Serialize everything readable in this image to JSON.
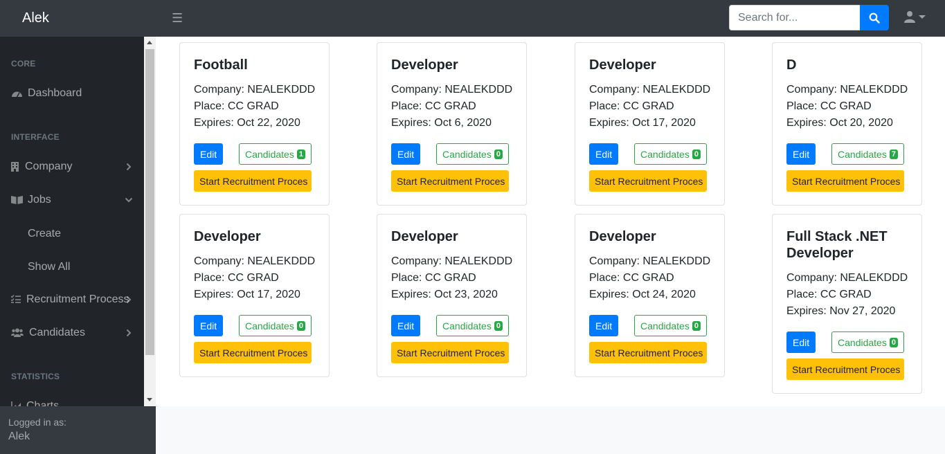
{
  "navbar": {
    "brand": "Alek",
    "search_placeholder": "Search for..."
  },
  "sidebar": {
    "headings": {
      "core": "CORE",
      "interface": "INTERFACE",
      "statistics": "STATISTICS"
    },
    "dashboard": "Dashboard",
    "company": "Company",
    "jobs": "Jobs",
    "jobs_sub": {
      "create": "Create",
      "show_all": "Show All"
    },
    "recruitment": "Recruitment Process",
    "candidates": "Candidates",
    "charts": "Charts",
    "footer": {
      "label": "Logged in as:",
      "user": "Alek"
    }
  },
  "card_labels": {
    "company_prefix": "Company: ",
    "place_prefix": "Place: ",
    "expires_prefix": "Expires: ",
    "edit": "Edit",
    "candidates": "Candidates",
    "start": "Start Recruitment Proces"
  },
  "jobs": [
    {
      "title": "Football",
      "company": "NEALEKDDD",
      "place": "CC GRAD",
      "expires": "Oct 22, 2020",
      "candidates": "1"
    },
    {
      "title": "Developer",
      "company": "NEALEKDDD",
      "place": "CC GRAD",
      "expires": "Oct 6, 2020",
      "candidates": "0"
    },
    {
      "title": "Developer",
      "company": "NEALEKDDD",
      "place": "CC GRAD",
      "expires": "Oct 17, 2020",
      "candidates": "0"
    },
    {
      "title": "D",
      "company": "NEALEKDDD",
      "place": "CC GRAD",
      "expires": "Oct 20, 2020",
      "candidates": "7"
    },
    {
      "title": "Developer",
      "company": "NEALEKDDD",
      "place": "CC GRAD",
      "expires": "Oct 17, 2020",
      "candidates": "0"
    },
    {
      "title": "Developer",
      "company": "NEALEKDDD",
      "place": "CC GRAD",
      "expires": "Oct 23, 2020",
      "candidates": "0"
    },
    {
      "title": "Developer",
      "company": "NEALEKDDD",
      "place": "CC GRAD",
      "expires": "Oct 24, 2020",
      "candidates": "0"
    },
    {
      "title": "Full Stack .NET Developer",
      "company": "NEALEKDDD",
      "place": "CC GRAD",
      "expires": "Nov 27, 2020",
      "candidates": "0"
    }
  ]
}
